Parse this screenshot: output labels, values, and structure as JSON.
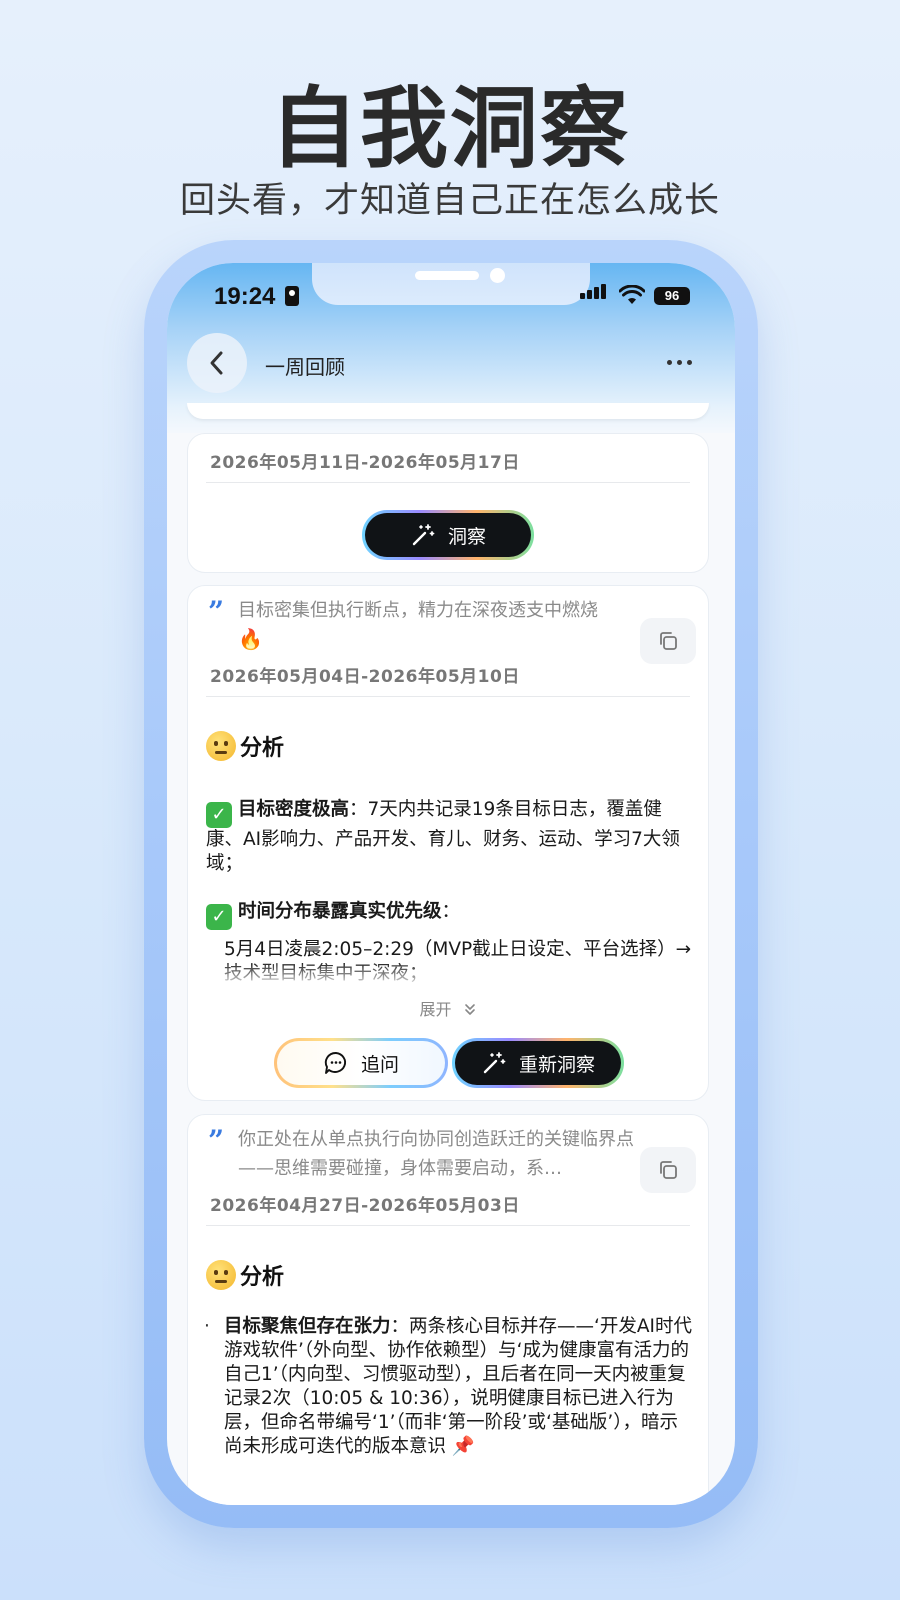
{
  "hero": {
    "title": "自我洞察",
    "subtitle": "回头看，才知道自己正在怎么成长"
  },
  "status_bar": {
    "time": "19:24",
    "battery": "96"
  },
  "nav": {
    "title": "一周回顾"
  },
  "cards": [
    {
      "date_range": "2026年05月11日-2026年05月17日",
      "insight_button": "洞察"
    },
    {
      "quote": "目标密集但执行断点，精力在深夜透支中燃烧",
      "quote_emoji": "🔥",
      "date_range": "2026年05月04日-2026年05月10日",
      "section_title": "分析",
      "point1_title": "目标密度极高",
      "point1_text": "：7天内共记录19条目标日志，覆盖健康、AI影响力、产品开发、育儿、财务、运动、学习7大领域；",
      "point2_title": "时间分布暴露真实优先级",
      "point2_text": "：",
      "bullet1": "5月4日凌晨2:05–2:29（MVP截止日设定、平台选择）→ 技术型目标集中于深夜；",
      "expand_label": "展开",
      "ask_button": "追问",
      "reinsight_button": "重新洞察"
    },
    {
      "quote": "你正处在从单点执行向协同创造跃迁的关键临界点——思维需要碰撞，身体需要启动，系…",
      "date_range": "2026年04月27日-2026年05月03日",
      "section_title": "分析",
      "bullet1_title": "目标聚焦但存在张力",
      "bullet1_text": "：两条核心目标并存——‘开发AI时代游戏软件’（外向型、协作依赖型）与‘成为健康富有活力的自己1’（内向型、习惯驱动型），且后者在同一天内被重复记录2次（10:05 & 10:36），说明健康目标已进入行为层，但命名带编号‘1’（而非‘第一阶段’或‘基础版’），暗示尚未形成可迭代的版本意识 📌"
    }
  ],
  "icons": {
    "back": "chevron-left-icon",
    "more": "more-dots-icon",
    "wand": "magic-wand-icon",
    "copy": "copy-icon",
    "chat": "chat-bubble-icon",
    "expand": "chevron-double-down-icon"
  }
}
